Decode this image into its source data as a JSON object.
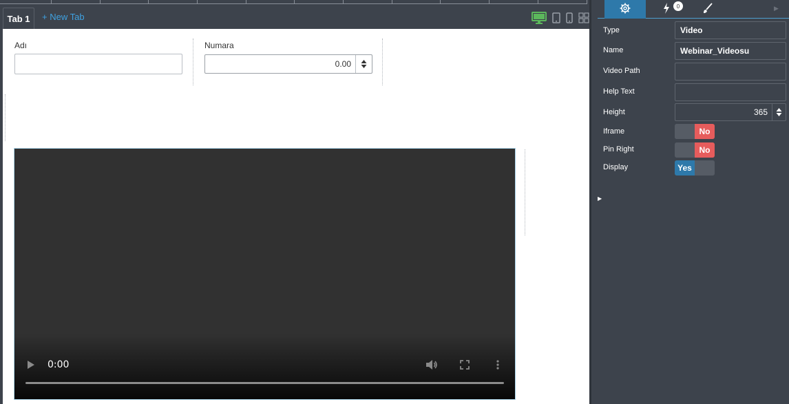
{
  "tabs": {
    "active_label": "Tab 1",
    "new_tab_label": "+ New Tab"
  },
  "device_icons": [
    "desktop-icon",
    "tablet-icon",
    "mobile-icon",
    "grid-icon"
  ],
  "form": {
    "name_label": "Adı",
    "name_value": "",
    "number_label": "Numara",
    "number_value": "0.00"
  },
  "video": {
    "time": "0:00",
    "progress": 0
  },
  "panel": {
    "tabs": [
      "gear-icon",
      "lightning-icon",
      "brush-icon"
    ],
    "events_badge": "0",
    "properties": {
      "type_label": "Type",
      "type_value": "Video",
      "name_label": "Name",
      "name_value": "Webinar_Videosu",
      "video_path_label": "Video Path",
      "video_path_value": "",
      "help_text_label": "Help Text",
      "help_text_value": "",
      "height_label": "Height",
      "height_value": "365",
      "iframe_label": "Iframe",
      "iframe_value": "No",
      "pin_right_label": "Pin Right",
      "pin_right_value": "No",
      "display_label": "Display",
      "display_value": "Yes"
    }
  },
  "colors": {
    "panel_bg": "#3d434c",
    "accent_blue": "#2e79aa",
    "link_blue": "#3fa1e0",
    "toggle_no": "#e65c5c",
    "active_device": "#5cb85c"
  }
}
